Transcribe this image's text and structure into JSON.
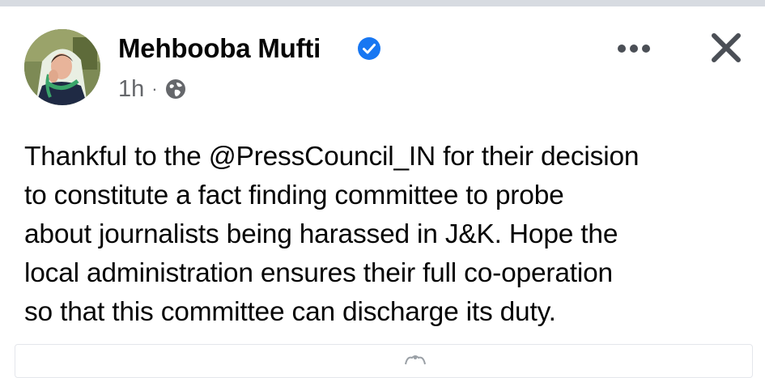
{
  "post": {
    "author_name": "Mehbooba Mufti",
    "time": "1h",
    "separator": "·",
    "audience_icon": "globe-icon",
    "verified_icon": "verified-badge-icon",
    "more_icon": "more-horizontal-icon",
    "close_icon": "close-icon",
    "text": "Thankful to the @PressCouncil_IN for their decision\nto constitute a fact finding committee to probe\nabout journalists being harassed in J&K. Hope the\nlocal administration ensures their full co-operation\nso that this committee can discharge its duty."
  },
  "colors": {
    "verified_blue": "#1877f2",
    "secondary_text": "#65676b",
    "icon_dark": "#4b4f56",
    "top_strip": "#d7dbe1"
  }
}
